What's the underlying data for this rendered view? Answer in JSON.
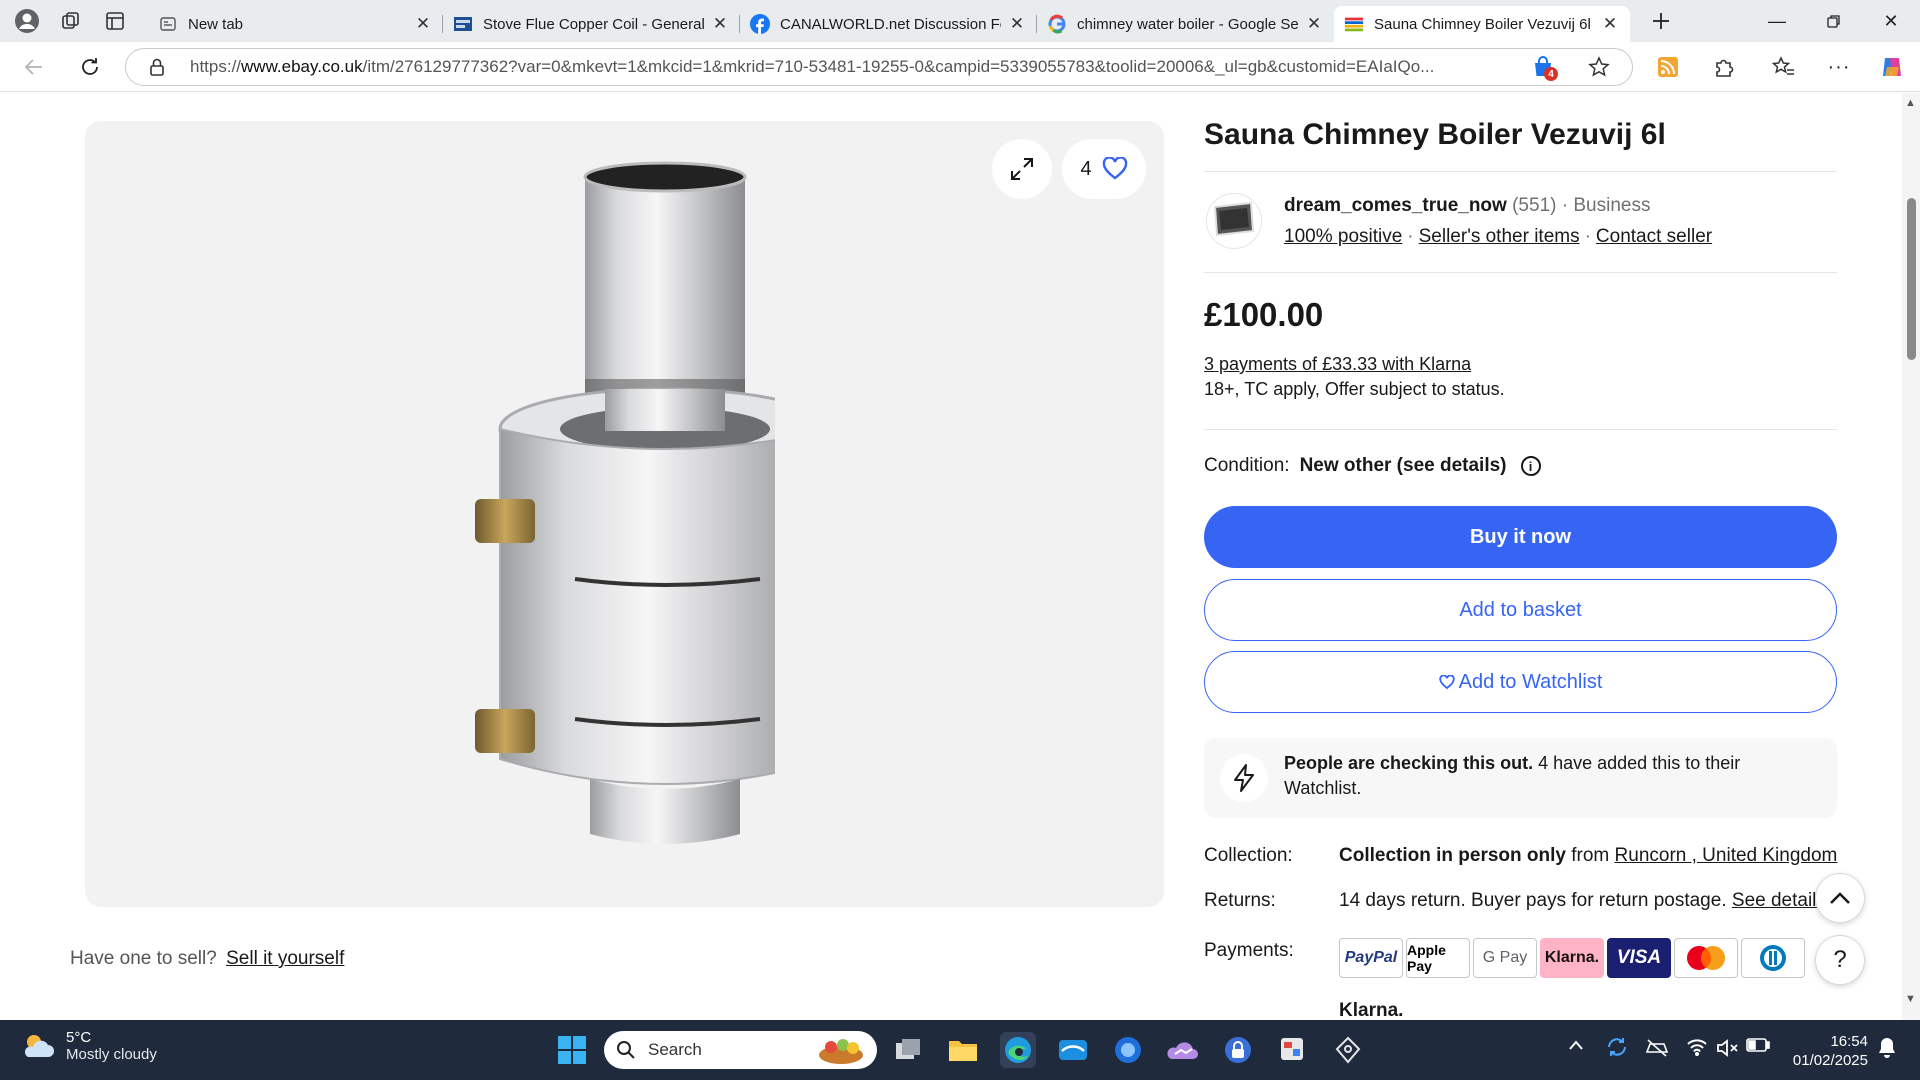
{
  "browser": {
    "tabs": [
      {
        "title": "New tab",
        "icon": "newtab-icon"
      },
      {
        "title": "Stove Flue Copper Coil - General",
        "icon": "canalworld-icon"
      },
      {
        "title": "CANALWORLD.net Discussion For",
        "icon": "facebook-icon"
      },
      {
        "title": "chimney water boiler - Google Se",
        "icon": "google-icon"
      },
      {
        "title": "Sauna Chimney Boiler Vezuvij 6l |",
        "icon": "ebay-icon"
      }
    ],
    "url_prefix": "https://",
    "url_domain": "www.ebay.co.uk",
    "url_rest": "/itm/276129777362?var=0&mkevt=1&mkcid=1&mkrid=710-53481-19255-0&campid=5339055783&toolid=20006&_ul=gb&customid=EAIaIQo...",
    "extension_badge": "4"
  },
  "listing": {
    "title": "Sauna Chimney Boiler Vezuvij 6l",
    "watch_count": "4",
    "seller": {
      "name": "dream_comes_true_now",
      "feedback": "(551)",
      "type": "Business",
      "positive": "100% positive",
      "other_items": "Seller's other items",
      "contact": "Contact seller"
    },
    "price": "£100.00",
    "klarna_link": "3 payments of £33.33 with Klarna",
    "klarna_note": "18+, TC apply, Offer subject to status.",
    "condition_label": "Condition:",
    "condition_value": "New other (see details)",
    "buy_now": "Buy it now",
    "add_basket": "Add to basket",
    "add_watchlist": "Add to Watchlist",
    "urgency_bold": "People are checking this out.",
    "urgency_text": "4 have added this to their Watchlist.",
    "collection_label": "Collection:",
    "collection_bold": "Collection in person only",
    "collection_from": "from",
    "collection_place": "Runcorn , United Kingdom",
    "returns_label": "Returns:",
    "returns_text": "14 days return. Buyer pays for return postage.",
    "returns_link": "See details",
    "payments_label": "Payments:",
    "payments": [
      "PayPal",
      "Apple Pay",
      "G Pay",
      "Klarna.",
      "VISA",
      "Mastercard",
      "Diners Club"
    ],
    "payments_footer": "Klarna.",
    "sell_prompt": "Have one to sell?",
    "sell_link": "Sell it yourself",
    "help": "?"
  },
  "taskbar": {
    "temp": "5°C",
    "weather": "Mostly cloudy",
    "search_placeholder": "Search",
    "time": "16:54",
    "date": "01/02/2025"
  }
}
